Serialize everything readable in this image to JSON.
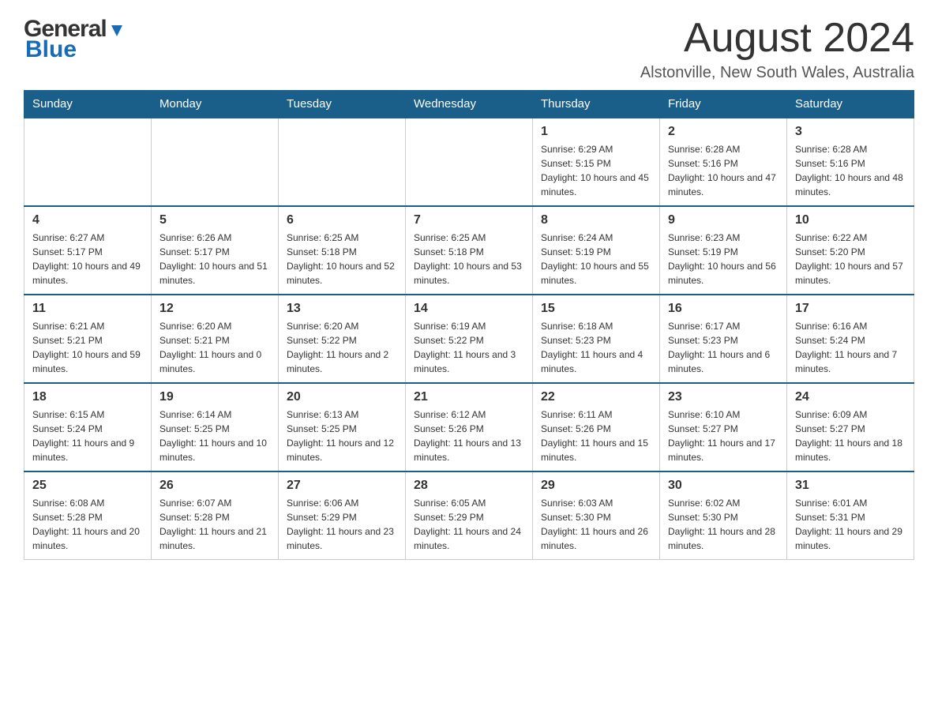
{
  "header": {
    "logo_general": "General",
    "logo_blue": "Blue",
    "month_title": "August 2024",
    "location": "Alstonville, New South Wales, Australia"
  },
  "days_of_week": [
    "Sunday",
    "Monday",
    "Tuesday",
    "Wednesday",
    "Thursday",
    "Friday",
    "Saturday"
  ],
  "weeks": [
    {
      "days": [
        {
          "date": "",
          "info": ""
        },
        {
          "date": "",
          "info": ""
        },
        {
          "date": "",
          "info": ""
        },
        {
          "date": "",
          "info": ""
        },
        {
          "date": "1",
          "info": "Sunrise: 6:29 AM\nSunset: 5:15 PM\nDaylight: 10 hours and 45 minutes."
        },
        {
          "date": "2",
          "info": "Sunrise: 6:28 AM\nSunset: 5:16 PM\nDaylight: 10 hours and 47 minutes."
        },
        {
          "date": "3",
          "info": "Sunrise: 6:28 AM\nSunset: 5:16 PM\nDaylight: 10 hours and 48 minutes."
        }
      ]
    },
    {
      "days": [
        {
          "date": "4",
          "info": "Sunrise: 6:27 AM\nSunset: 5:17 PM\nDaylight: 10 hours and 49 minutes."
        },
        {
          "date": "5",
          "info": "Sunrise: 6:26 AM\nSunset: 5:17 PM\nDaylight: 10 hours and 51 minutes."
        },
        {
          "date": "6",
          "info": "Sunrise: 6:25 AM\nSunset: 5:18 PM\nDaylight: 10 hours and 52 minutes."
        },
        {
          "date": "7",
          "info": "Sunrise: 6:25 AM\nSunset: 5:18 PM\nDaylight: 10 hours and 53 minutes."
        },
        {
          "date": "8",
          "info": "Sunrise: 6:24 AM\nSunset: 5:19 PM\nDaylight: 10 hours and 55 minutes."
        },
        {
          "date": "9",
          "info": "Sunrise: 6:23 AM\nSunset: 5:19 PM\nDaylight: 10 hours and 56 minutes."
        },
        {
          "date": "10",
          "info": "Sunrise: 6:22 AM\nSunset: 5:20 PM\nDaylight: 10 hours and 57 minutes."
        }
      ]
    },
    {
      "days": [
        {
          "date": "11",
          "info": "Sunrise: 6:21 AM\nSunset: 5:21 PM\nDaylight: 10 hours and 59 minutes."
        },
        {
          "date": "12",
          "info": "Sunrise: 6:20 AM\nSunset: 5:21 PM\nDaylight: 11 hours and 0 minutes."
        },
        {
          "date": "13",
          "info": "Sunrise: 6:20 AM\nSunset: 5:22 PM\nDaylight: 11 hours and 2 minutes."
        },
        {
          "date": "14",
          "info": "Sunrise: 6:19 AM\nSunset: 5:22 PM\nDaylight: 11 hours and 3 minutes."
        },
        {
          "date": "15",
          "info": "Sunrise: 6:18 AM\nSunset: 5:23 PM\nDaylight: 11 hours and 4 minutes."
        },
        {
          "date": "16",
          "info": "Sunrise: 6:17 AM\nSunset: 5:23 PM\nDaylight: 11 hours and 6 minutes."
        },
        {
          "date": "17",
          "info": "Sunrise: 6:16 AM\nSunset: 5:24 PM\nDaylight: 11 hours and 7 minutes."
        }
      ]
    },
    {
      "days": [
        {
          "date": "18",
          "info": "Sunrise: 6:15 AM\nSunset: 5:24 PM\nDaylight: 11 hours and 9 minutes."
        },
        {
          "date": "19",
          "info": "Sunrise: 6:14 AM\nSunset: 5:25 PM\nDaylight: 11 hours and 10 minutes."
        },
        {
          "date": "20",
          "info": "Sunrise: 6:13 AM\nSunset: 5:25 PM\nDaylight: 11 hours and 12 minutes."
        },
        {
          "date": "21",
          "info": "Sunrise: 6:12 AM\nSunset: 5:26 PM\nDaylight: 11 hours and 13 minutes."
        },
        {
          "date": "22",
          "info": "Sunrise: 6:11 AM\nSunset: 5:26 PM\nDaylight: 11 hours and 15 minutes."
        },
        {
          "date": "23",
          "info": "Sunrise: 6:10 AM\nSunset: 5:27 PM\nDaylight: 11 hours and 17 minutes."
        },
        {
          "date": "24",
          "info": "Sunrise: 6:09 AM\nSunset: 5:27 PM\nDaylight: 11 hours and 18 minutes."
        }
      ]
    },
    {
      "days": [
        {
          "date": "25",
          "info": "Sunrise: 6:08 AM\nSunset: 5:28 PM\nDaylight: 11 hours and 20 minutes."
        },
        {
          "date": "26",
          "info": "Sunrise: 6:07 AM\nSunset: 5:28 PM\nDaylight: 11 hours and 21 minutes."
        },
        {
          "date": "27",
          "info": "Sunrise: 6:06 AM\nSunset: 5:29 PM\nDaylight: 11 hours and 23 minutes."
        },
        {
          "date": "28",
          "info": "Sunrise: 6:05 AM\nSunset: 5:29 PM\nDaylight: 11 hours and 24 minutes."
        },
        {
          "date": "29",
          "info": "Sunrise: 6:03 AM\nSunset: 5:30 PM\nDaylight: 11 hours and 26 minutes."
        },
        {
          "date": "30",
          "info": "Sunrise: 6:02 AM\nSunset: 5:30 PM\nDaylight: 11 hours and 28 minutes."
        },
        {
          "date": "31",
          "info": "Sunrise: 6:01 AM\nSunset: 5:31 PM\nDaylight: 11 hours and 29 minutes."
        }
      ]
    }
  ]
}
